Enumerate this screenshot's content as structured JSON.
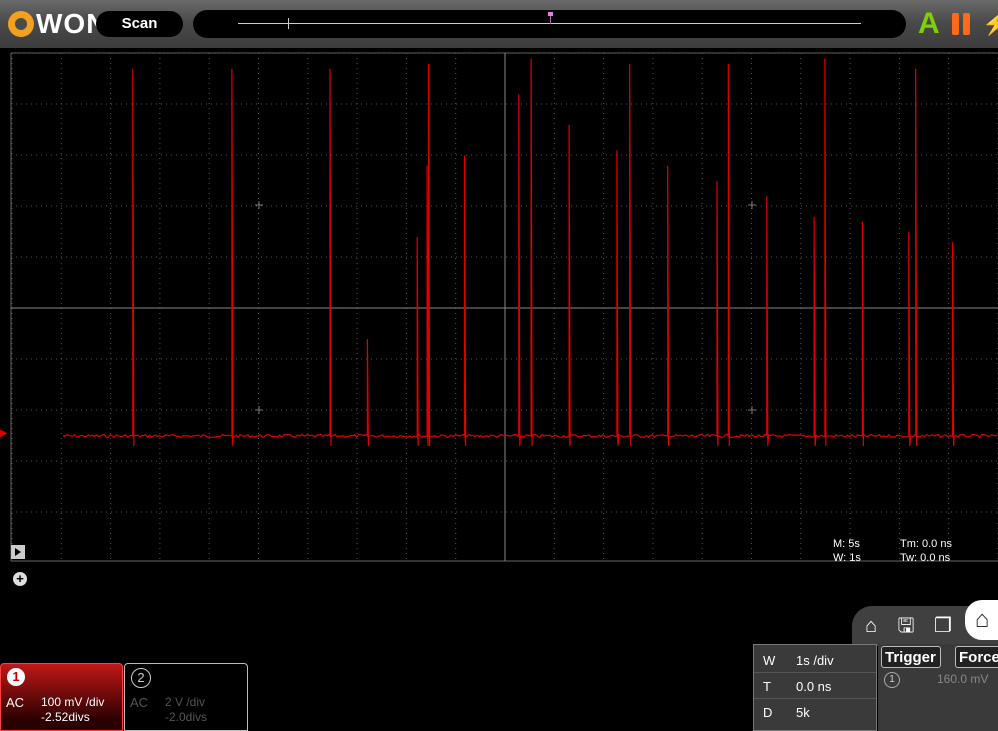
{
  "brand": {
    "logo_text": "WON"
  },
  "topbar": {
    "mode_label": "Scan",
    "auto_label": "A"
  },
  "readouts": {
    "m": "M: 5s",
    "w": "W: 1s",
    "tm": "Tm: 0.0 ns",
    "tw": "Tw: 0.0 ns"
  },
  "channels": [
    {
      "number": "1",
      "coupling": "AC",
      "scale": "100 mV /div",
      "offset": "-2.52divs",
      "color": "#e00000"
    },
    {
      "number": "2",
      "coupling": "AC",
      "scale": "2 V /div",
      "offset": "-2.0divs",
      "color": "#555555"
    }
  ],
  "timebase": {
    "rows": [
      {
        "key": "W",
        "value": "1s /div"
      },
      {
        "key": "T",
        "value": "0.0 ns"
      },
      {
        "key": "D",
        "value": "5k"
      }
    ]
  },
  "trigger_panel": {
    "trigger_label": "Trigger",
    "force_label": "Force",
    "level": "160.0 mV"
  },
  "icons": [
    "home-search-icon",
    "save-icon",
    "copy-icon",
    "home-icon",
    "pause-icon",
    "bolt-icon",
    "play-icon",
    "plus-icon"
  ],
  "chart_data": {
    "type": "line",
    "grid": true,
    "series": [
      {
        "color": "#e00000",
        "baseline_div": 2.52,
        "spikes": [
          {
            "t": 2.47,
            "h": 7.2
          },
          {
            "t": 4.48,
            "h": 7.2
          },
          {
            "t": 6.47,
            "h": 7.2
          },
          {
            "t": 7.23,
            "h": 1.9
          },
          {
            "t": 8.24,
            "h": 3.9
          },
          {
            "t": 8.44,
            "h": 5.3
          },
          {
            "t": 8.47,
            "h": 7.3
          },
          {
            "t": 9.2,
            "h": 5.5
          },
          {
            "t": 10.3,
            "h": 6.7
          },
          {
            "t": 10.55,
            "h": 7.4
          },
          {
            "t": 11.32,
            "h": 6.1
          },
          {
            "t": 12.29,
            "h": 5.6
          },
          {
            "t": 12.55,
            "h": 7.3
          },
          {
            "t": 13.32,
            "h": 5.3
          },
          {
            "t": 14.32,
            "h": 5.0
          },
          {
            "t": 14.55,
            "h": 7.3
          },
          {
            "t": 15.33,
            "h": 4.7
          },
          {
            "t": 16.29,
            "h": 4.3
          },
          {
            "t": 16.51,
            "h": 7.4
          },
          {
            "t": 17.27,
            "h": 4.2
          },
          {
            "t": 18.21,
            "h": 4.0
          },
          {
            "t": 18.35,
            "h": 7.2
          },
          {
            "t": 19.1,
            "h": 3.8
          }
        ]
      }
    ]
  }
}
